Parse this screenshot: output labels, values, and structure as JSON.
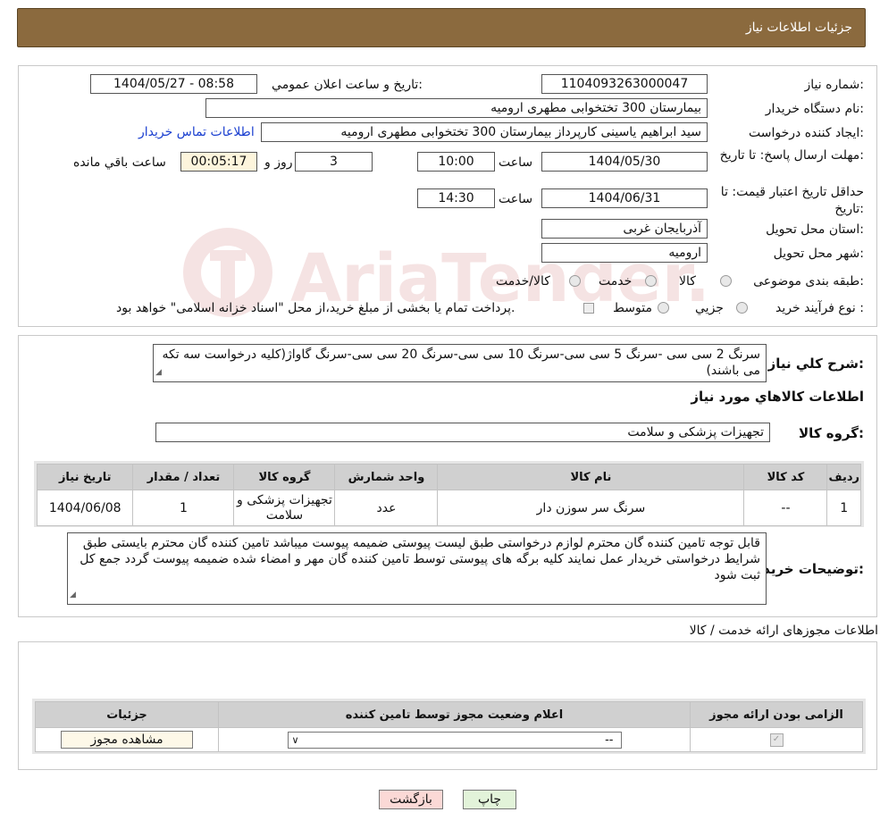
{
  "header": {
    "title": "جزئیات اطلاعات نیاز"
  },
  "details": {
    "need_number_label": "شماره نیاز:",
    "need_number": "1104093263000047",
    "announce_label": "تاریخ و ساعت اعلان عمومي:",
    "announce_value": "1404/05/27 - 08:58",
    "buyer_org_label": "نام دستگاه خریدار:",
    "buyer_org": "بیمارستان 300 تختخوابی مطهری  ارومیه",
    "requester_label": "ایجاد کننده درخواست:",
    "requester": "سید ابراهیم یاسینی کارپرداز بیمارستان 300 تختخوابی مطهری  ارومیه",
    "contact_link": "اطلاعات تماس خریدار",
    "deadline_label": "مهلت ارسال پاسخ: تا تاریخ:",
    "deadline_date": "1404/05/30",
    "time_label": "ساعت",
    "deadline_time": "10:00",
    "days_value": "3",
    "days_label": "روز و",
    "remaining_time": "00:05:17",
    "remaining_label": "ساعت باقي مانده",
    "validity_label": "حداقل تاریخ اعتبار قیمت: تا تاریخ:",
    "validity_date": "1404/06/31",
    "validity_time": "14:30",
    "province_label": "استان محل تحویل:",
    "province": "آذربایجان غربی",
    "city_label": "شهر محل تحویل:",
    "city": "ارومیه",
    "category_label": "طبقه بندی موضوعی:",
    "category_options": [
      "کالا",
      "خدمت",
      "کالا/خدمت"
    ],
    "purchase_type_label": "نوع فرآیند خرید :",
    "purchase_options": [
      "جزیي",
      "متوسط"
    ],
    "purchase_note": "پرداخت تمام یا بخشی از مبلغ خرید،از محل \"اسناد خزانه اسلامی\" خواهد بود."
  },
  "description": {
    "label": "شرح کلي نياز:",
    "text": "سرنگ 2 سی سی -سرنگ 5 سی سی-سرنگ 10 سی سی-سرنگ 20 سی سی-سرنگ گاواژ(کلیه درخواست سه تکه می باشند)"
  },
  "goods": {
    "section_title": "اطلاعات کالاهاي مورد نياز",
    "group_label": "گروه کالا:",
    "group_value": "تجهیزات پزشکی و سلامت",
    "columns": [
      "رديف",
      "کد کالا",
      "نام کالا",
      "واحد شمارش",
      "گروه کالا",
      "تعداد / مقدار",
      "تاريخ نياز"
    ],
    "rows": [
      [
        "1",
        "--",
        "سرنگ سر سوزن دار",
        "عدد",
        "تجهیزات پزشکی و سلامت",
        "1",
        "1404/06/08"
      ]
    ]
  },
  "buyer_notes": {
    "label": "توضيحات خريدار:",
    "text": "قابل توجه تامین کننده گان محترم لوازم درخواستی طبق لیست پیوستی ضمیمه پیوست میباشد تامین کننده گان محترم بایستی طبق شرایط درخواستی خریدار عمل نمایند کلیه برگه های پیوستی توسط تامین کننده گان مهر و امضاء شده ضمیمه پیوست گردد جمع کل ثبت شود"
  },
  "licenses": {
    "title": "اطلاعات مجوزهای ارائه خدمت / کالا",
    "columns": [
      "الزامی بودن ارائه مجوز",
      "اعلام وضعیت مجوز توسط تامین کننده",
      "جزئیات"
    ],
    "select_value": "--",
    "view_button": "مشاهده مجوز"
  },
  "footer": {
    "print_button": "چاپ",
    "back_button": "بازگشت"
  },
  "watermark": {
    "text": "AriaTender.neT"
  },
  "colors": {
    "header_bg": "#8b6a3e",
    "link": "#1a3fd0",
    "yellow_box": "#fdf5dc",
    "back_btn": "#fbd9d6",
    "print_btn": "#e2f3d9"
  }
}
